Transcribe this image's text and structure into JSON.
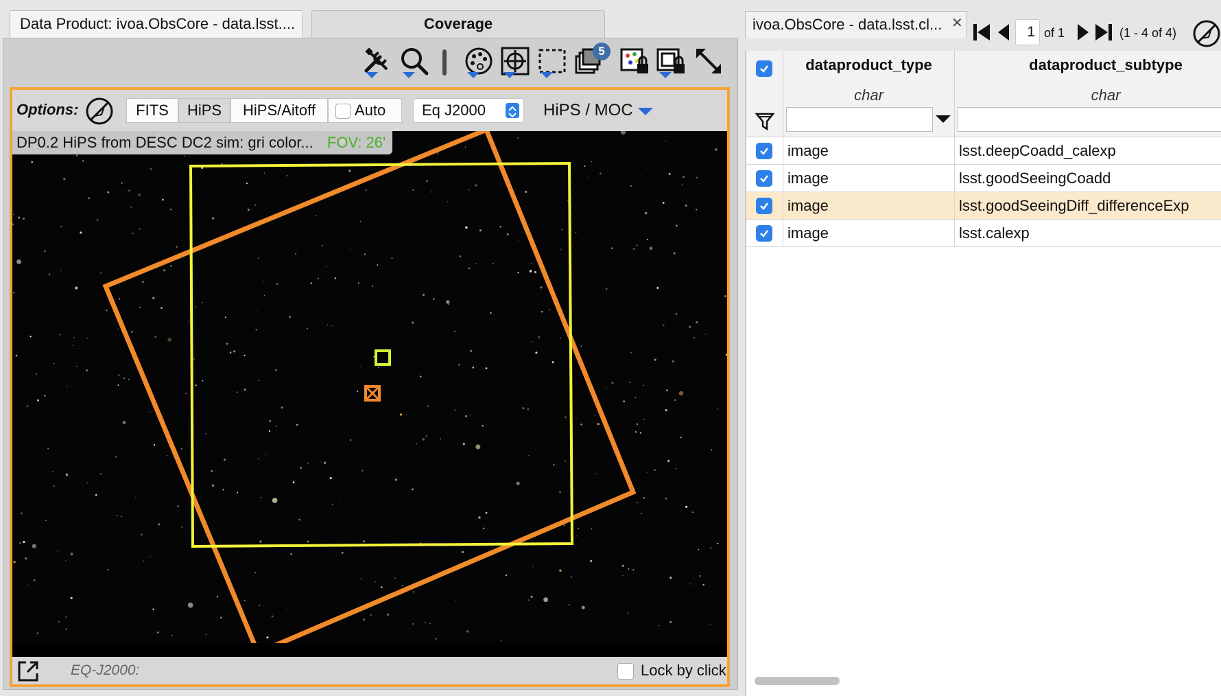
{
  "left_tabs": {
    "inactive": "Data Product: ivoa.ObsCore - data.lsst....",
    "active": "Coverage"
  },
  "toolbar": {
    "icons": [
      "tools-icon",
      "zoom-icon",
      "divider",
      "color-palette-icon",
      "target-icon",
      "select-area-icon",
      "layers-icon",
      "image-lock-icon",
      "image-lock-drop-icon",
      "expand-icon"
    ],
    "layers_badge": "5"
  },
  "options": {
    "label": "Options:",
    "buttons": [
      "FITS",
      "HiPS",
      "HiPS/Aitoff"
    ],
    "active_button": "HiPS",
    "auto_label": "Auto",
    "auto_checked": false,
    "coord_system": "Eq J2000",
    "hips_moc_label": "HiPS / MOC"
  },
  "viewer": {
    "title": "DP0.2 HiPS from DESC DC2 sim: gri color...",
    "fov": "FOV: 26'",
    "coord_readout": "EQ-J2000:",
    "lock_label": "Lock by click",
    "lock_checked": false,
    "colors": {
      "orange_footprint": "#f08a2a",
      "yellow_footprint": "#f2f23a",
      "frame": "#f5a23a"
    }
  },
  "right_tab": {
    "label": "ivoa.ObsCore - data.lsst.cl..."
  },
  "pager": {
    "page_value": "1",
    "of_label": "of 1",
    "range_label": "(1 - 4 of 4)"
  },
  "table": {
    "columns": [
      {
        "name": "dataproduct_type",
        "type": "char"
      },
      {
        "name": "dataproduct_subtype",
        "type": "char"
      }
    ],
    "rows": [
      {
        "type": "image",
        "subtype": "lsst.deepCoadd_calexp",
        "checked": true,
        "highlighted": false
      },
      {
        "type": "image",
        "subtype": "lsst.goodSeeingCoadd",
        "checked": true,
        "highlighted": false
      },
      {
        "type": "image",
        "subtype": "lsst.goodSeeingDiff_differenceExp",
        "checked": true,
        "highlighted": true
      },
      {
        "type": "image",
        "subtype": "lsst.calexp",
        "checked": true,
        "highlighted": false
      }
    ]
  }
}
